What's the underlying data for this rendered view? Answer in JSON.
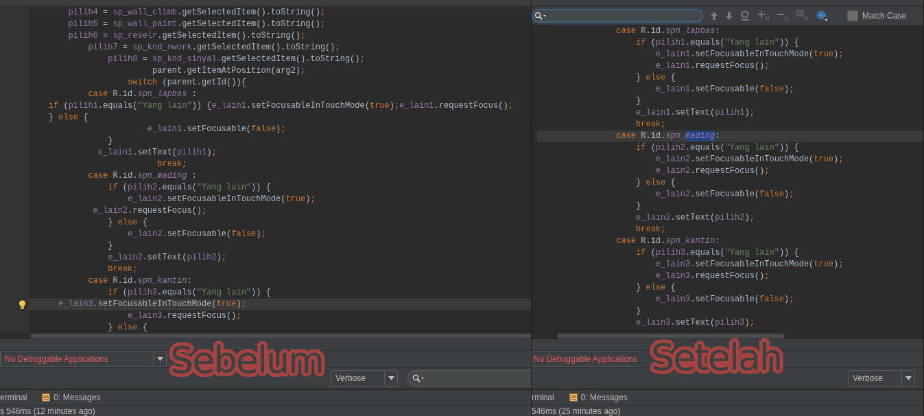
{
  "panels": [
    {
      "editor": {
        "lines": [
          {
            "current": false,
            "tokens": [
              {
                "text": "        pilih4",
                "kind": "v"
              },
              {
                "text": " = ",
                "kind": "p"
              },
              {
                "text": "sp_wall_climb",
                "kind": "v"
              },
              {
                "text": ".getSelectedItem().toString()",
                "kind": "p"
              },
              {
                "text": ";",
                "kind": "k"
              }
            ]
          },
          {
            "current": false,
            "tokens": [
              {
                "text": "        pilih5",
                "kind": "v"
              },
              {
                "text": " = ",
                "kind": "p"
              },
              {
                "text": "sp_wall_paint",
                "kind": "v"
              },
              {
                "text": ".getSelectedItem().toString()",
                "kind": "p"
              },
              {
                "text": ";",
                "kind": "k"
              }
            ]
          },
          {
            "current": false,
            "tokens": [
              {
                "text": "        pilih6",
                "kind": "v"
              },
              {
                "text": " = ",
                "kind": "p"
              },
              {
                "text": "sp_reselr",
                "kind": "v"
              },
              {
                "text": ".getSelectedItem().toString()",
                "kind": "p"
              },
              {
                "text": ";",
                "kind": "k"
              }
            ]
          },
          {
            "current": false,
            "tokens": [
              {
                "text": "            pilih7",
                "kind": "v"
              },
              {
                "text": " = ",
                "kind": "p"
              },
              {
                "text": "sp_knd_nwork",
                "kind": "v"
              },
              {
                "text": ".getSelectedItem().toString()",
                "kind": "p"
              },
              {
                "text": ";",
                "kind": "k"
              }
            ]
          },
          {
            "current": false,
            "tokens": [
              {
                "text": "                pilih8",
                "kind": "v"
              },
              {
                "text": " = ",
                "kind": "p"
              },
              {
                "text": "sp_knd_sinyal",
                "kind": "v"
              },
              {
                "text": ".getSelectedItem().toString()",
                "kind": "p"
              },
              {
                "text": ";",
                "kind": "k"
              }
            ]
          },
          {
            "current": false,
            "tokens": [
              {
                "text": "                         parent.getItemAtPosition(arg2)",
                "kind": "p"
              },
              {
                "text": ";",
                "kind": "k"
              }
            ]
          },
          {
            "current": false,
            "tokens": [
              {
                "text": "                    switch",
                "kind": "k"
              },
              {
                "text": " (parent.getId()){",
                "kind": "p"
              }
            ]
          },
          {
            "current": false,
            "tokens": [
              {
                "text": "            case",
                "kind": "k"
              },
              {
                "text": " R.id.",
                "kind": "p"
              },
              {
                "text": "spn_lapbas",
                "kind": "f"
              },
              {
                "text": " :",
                "kind": "p"
              }
            ]
          },
          {
            "current": false,
            "tokens": [
              {
                "text": "    if",
                "kind": "k"
              },
              {
                "text": " (",
                "kind": "p"
              },
              {
                "text": "pilih1",
                "kind": "v"
              },
              {
                "text": ".equals(",
                "kind": "p"
              },
              {
                "text": "\"Yang lain\"",
                "kind": "s"
              },
              {
                "text": ")) {",
                "kind": "p"
              },
              {
                "text": "e_lain1",
                "kind": "v"
              },
              {
                "text": ".setFocusableInTouchMode(",
                "kind": "p"
              },
              {
                "text": "true",
                "kind": "k"
              },
              {
                "text": ")",
                "kind": "p"
              },
              {
                "text": ";",
                "kind": "k"
              },
              {
                "text": "e_lain1",
                "kind": "v"
              },
              {
                "text": ".requestFocus()",
                "kind": "p"
              },
              {
                "text": ";",
                "kind": "k"
              }
            ]
          },
          {
            "current": false,
            "tokens": [
              {
                "text": "    } ",
                "kind": "p"
              },
              {
                "text": "else",
                "kind": "k"
              },
              {
                "text": " {",
                "kind": "p"
              }
            ]
          },
          {
            "current": false,
            "tokens": [
              {
                "text": "                        e_lain1",
                "kind": "v"
              },
              {
                "text": ".setFocusable(",
                "kind": "p"
              },
              {
                "text": "false",
                "kind": "k"
              },
              {
                "text": ")",
                "kind": "p"
              },
              {
                "text": ";",
                "kind": "k"
              }
            ]
          },
          {
            "current": false,
            "tokens": [
              {
                "text": "                }",
                "kind": "p"
              }
            ]
          },
          {
            "current": false,
            "tokens": [
              {
                "text": "              e_lain1",
                "kind": "v"
              },
              {
                "text": ".setText(",
                "kind": "p"
              },
              {
                "text": "pilih1",
                "kind": "v"
              },
              {
                "text": ")",
                "kind": "p"
              },
              {
                "text": ";",
                "kind": "k"
              }
            ]
          },
          {
            "current": false,
            "tokens": [
              {
                "text": "                          break;",
                "kind": "k"
              }
            ]
          },
          {
            "current": false,
            "tokens": [
              {
                "text": "            case",
                "kind": "k"
              },
              {
                "text": " R.id.",
                "kind": "p"
              },
              {
                "text": "spn_mading",
                "kind": "f"
              },
              {
                "text": " :",
                "kind": "p"
              }
            ]
          },
          {
            "current": false,
            "tokens": [
              {
                "text": "                if",
                "kind": "k"
              },
              {
                "text": " (",
                "kind": "p"
              },
              {
                "text": "pilih2",
                "kind": "v"
              },
              {
                "text": ".equals(",
                "kind": "p"
              },
              {
                "text": "\"Yang lain\"",
                "kind": "s"
              },
              {
                "text": ")) {",
                "kind": "p"
              }
            ]
          },
          {
            "current": false,
            "tokens": [
              {
                "text": "                    e_lain2",
                "kind": "v"
              },
              {
                "text": ".setFocusableInTouchMode(",
                "kind": "p"
              },
              {
                "text": "true",
                "kind": "k"
              },
              {
                "text": ")",
                "kind": "p"
              },
              {
                "text": ";",
                "kind": "k"
              }
            ]
          },
          {
            "current": false,
            "tokens": [
              {
                "text": "             e_lain2",
                "kind": "v"
              },
              {
                "text": ".requestFocus()",
                "kind": "p"
              },
              {
                "text": ";",
                "kind": "k"
              }
            ]
          },
          {
            "current": false,
            "tokens": [
              {
                "text": "                } ",
                "kind": "p"
              },
              {
                "text": "else",
                "kind": "k"
              },
              {
                "text": " {",
                "kind": "p"
              }
            ]
          },
          {
            "current": false,
            "tokens": [
              {
                "text": "                    e_lain2",
                "kind": "v"
              },
              {
                "text": ".setFocusable(",
                "kind": "p"
              },
              {
                "text": "false",
                "kind": "k"
              },
              {
                "text": ")",
                "kind": "p"
              },
              {
                "text": ";",
                "kind": "k"
              }
            ]
          },
          {
            "current": false,
            "tokens": [
              {
                "text": "                }",
                "kind": "p"
              }
            ]
          },
          {
            "current": false,
            "tokens": [
              {
                "text": "                e_lain2",
                "kind": "v"
              },
              {
                "text": ".setText(",
                "kind": "p"
              },
              {
                "text": "pilih2",
                "kind": "v"
              },
              {
                "text": ")",
                "kind": "p"
              },
              {
                "text": ";",
                "kind": "k"
              }
            ]
          },
          {
            "current": false,
            "tokens": [
              {
                "text": "                break;",
                "kind": "k"
              }
            ]
          },
          {
            "current": false,
            "tokens": [
              {
                "text": "            case",
                "kind": "k"
              },
              {
                "text": " R.id.",
                "kind": "p"
              },
              {
                "text": "spn_kantin",
                "kind": "f"
              },
              {
                "text": ":",
                "kind": "p"
              }
            ]
          },
          {
            "current": false,
            "tokens": [
              {
                "text": "                if",
                "kind": "k"
              },
              {
                "text": " (",
                "kind": "p"
              },
              {
                "text": "pilih3",
                "kind": "v"
              },
              {
                "text": ".equals(",
                "kind": "p"
              },
              {
                "text": "\"Yang lain\"",
                "kind": "s"
              },
              {
                "text": ")) {",
                "kind": "p"
              }
            ]
          },
          {
            "current": true,
            "bulb": true,
            "tokens": [
              {
                "text": "      e_lain3",
                "kind": "v"
              },
              {
                "text": ".setFocusableInTouchMode(",
                "kind": "p"
              },
              {
                "text": "true",
                "kind": "k"
              },
              {
                "text": ")",
                "kind": "p"
              },
              {
                "text": ";",
                "kind": "k"
              }
            ]
          },
          {
            "current": false,
            "tokens": [
              {
                "text": "                    e_lain3",
                "kind": "v"
              },
              {
                "text": ".requestFocus()",
                "kind": "p"
              },
              {
                "text": ";",
                "kind": "k"
              }
            ]
          },
          {
            "current": false,
            "tokens": [
              {
                "text": "                } ",
                "kind": "p"
              },
              {
                "text": "else",
                "kind": "k"
              },
              {
                "text": " {",
                "kind": "p"
              }
            ]
          }
        ]
      },
      "run_target": "No Debuggable Applications",
      "log_level": "Verbose",
      "log_search": true,
      "tool_windows": [
        {
          "label": "erminal",
          "kind": "plain"
        },
        {
          "label": "0: Messages",
          "kind": "messages"
        }
      ],
      "status": "s 546ms (12 minutes ago)",
      "overlay_label": "Sebelum"
    },
    {
      "find_bar": {
        "match_case": {
          "label": "Match Case",
          "checked": false
        }
      },
      "editor": {
        "lines": [
          {
            "current": false,
            "tokens": [
              {
                "text": "                case",
                "kind": "k"
              },
              {
                "text": " R.id.",
                "kind": "p"
              },
              {
                "text": "spn_lapbas",
                "kind": "f"
              },
              {
                "text": ":",
                "kind": "p"
              }
            ]
          },
          {
            "current": false,
            "tokens": [
              {
                "text": "                    if",
                "kind": "k"
              },
              {
                "text": " (",
                "kind": "p"
              },
              {
                "text": "pilih1",
                "kind": "v"
              },
              {
                "text": ".equals(",
                "kind": "p"
              },
              {
                "text": "\"Yang lain\"",
                "kind": "s"
              },
              {
                "text": ")) {",
                "kind": "p"
              }
            ]
          },
          {
            "current": false,
            "tokens": [
              {
                "text": "                        e_lain1",
                "kind": "v"
              },
              {
                "text": ".setFocusableInTouchMode(",
                "kind": "p"
              },
              {
                "text": "true",
                "kind": "k"
              },
              {
                "text": ")",
                "kind": "p"
              },
              {
                "text": ";",
                "kind": "k"
              }
            ]
          },
          {
            "current": false,
            "tokens": [
              {
                "text": "                        e_lain1",
                "kind": "v"
              },
              {
                "text": ".requestFocus()",
                "kind": "p"
              },
              {
                "text": ";",
                "kind": "k"
              }
            ]
          },
          {
            "current": false,
            "tokens": [
              {
                "text": "                    } ",
                "kind": "p"
              },
              {
                "text": "else",
                "kind": "k"
              },
              {
                "text": " {",
                "kind": "p"
              }
            ]
          },
          {
            "current": false,
            "tokens": [
              {
                "text": "                        e_lain1",
                "kind": "v"
              },
              {
                "text": ".setFocusable(",
                "kind": "p"
              },
              {
                "text": "false",
                "kind": "k"
              },
              {
                "text": ")",
                "kind": "p"
              },
              {
                "text": ";",
                "kind": "k"
              }
            ]
          },
          {
            "current": false,
            "tokens": [
              {
                "text": "                    }",
                "kind": "p"
              }
            ]
          },
          {
            "current": false,
            "tokens": [
              {
                "text": "                    e_lain1",
                "kind": "v"
              },
              {
                "text": ".setText(",
                "kind": "p"
              },
              {
                "text": "pilih1",
                "kind": "v"
              },
              {
                "text": ")",
                "kind": "p"
              },
              {
                "text": ";",
                "kind": "k"
              }
            ]
          },
          {
            "current": false,
            "tokens": [
              {
                "text": "                    break;",
                "kind": "k"
              }
            ]
          },
          {
            "current": true,
            "tokens": [
              {
                "text": "                case",
                "kind": "k"
              },
              {
                "text": " R.id.",
                "kind": "p"
              },
              {
                "text": "spn_",
                "kind": "f"
              },
              {
                "text": "mading",
                "kind": "fsel"
              },
              {
                "text": ":",
                "kind": "p"
              }
            ]
          },
          {
            "current": false,
            "tokens": [
              {
                "text": "                    if",
                "kind": "k"
              },
              {
                "text": " (",
                "kind": "p"
              },
              {
                "text": "pilih2",
                "kind": "v"
              },
              {
                "text": ".equals(",
                "kind": "p"
              },
              {
                "text": "\"Yang lain\"",
                "kind": "s"
              },
              {
                "text": ")) {",
                "kind": "p"
              }
            ]
          },
          {
            "current": false,
            "tokens": [
              {
                "text": "                        e_lain2",
                "kind": "v"
              },
              {
                "text": ".setFocusableInTouchMode(",
                "kind": "p"
              },
              {
                "text": "true",
                "kind": "k"
              },
              {
                "text": ")",
                "kind": "p"
              },
              {
                "text": ";",
                "kind": "k"
              }
            ]
          },
          {
            "current": false,
            "tokens": [
              {
                "text": "                        e_lain2",
                "kind": "v"
              },
              {
                "text": ".requestFocus()",
                "kind": "p"
              },
              {
                "text": ";",
                "kind": "k"
              }
            ]
          },
          {
            "current": false,
            "tokens": [
              {
                "text": "                    } ",
                "kind": "p"
              },
              {
                "text": "else",
                "kind": "k"
              },
              {
                "text": " {",
                "kind": "p"
              }
            ]
          },
          {
            "current": false,
            "tokens": [
              {
                "text": "                        e_lain2",
                "kind": "v"
              },
              {
                "text": ".setFocusable(",
                "kind": "p"
              },
              {
                "text": "false",
                "kind": "k"
              },
              {
                "text": ")",
                "kind": "p"
              },
              {
                "text": ";",
                "kind": "k"
              }
            ]
          },
          {
            "current": false,
            "tokens": [
              {
                "text": "                    }",
                "kind": "p"
              }
            ]
          },
          {
            "current": false,
            "tokens": [
              {
                "text": "                    e_lain2",
                "kind": "v"
              },
              {
                "text": ".setText(",
                "kind": "p"
              },
              {
                "text": "pilih2",
                "kind": "v"
              },
              {
                "text": ")",
                "kind": "p"
              },
              {
                "text": ";",
                "kind": "k"
              }
            ]
          },
          {
            "current": false,
            "tokens": [
              {
                "text": "                    break;",
                "kind": "k"
              }
            ]
          },
          {
            "current": false,
            "tokens": [
              {
                "text": "                case",
                "kind": "k"
              },
              {
                "text": " R.id.",
                "kind": "p"
              },
              {
                "text": "spn_kantin",
                "kind": "f"
              },
              {
                "text": ":",
                "kind": "p"
              }
            ]
          },
          {
            "current": false,
            "tokens": [
              {
                "text": "                    if",
                "kind": "k"
              },
              {
                "text": " (",
                "kind": "p"
              },
              {
                "text": "pilih3",
                "kind": "v"
              },
              {
                "text": ".equals(",
                "kind": "p"
              },
              {
                "text": "\"Yang lain\"",
                "kind": "s"
              },
              {
                "text": ")) {",
                "kind": "p"
              }
            ]
          },
          {
            "current": false,
            "tokens": [
              {
                "text": "                        e_lain3",
                "kind": "v"
              },
              {
                "text": ".setFocusableInTouchMode(",
                "kind": "p"
              },
              {
                "text": "true",
                "kind": "k"
              },
              {
                "text": ")",
                "kind": "p"
              },
              {
                "text": ";",
                "kind": "k"
              }
            ]
          },
          {
            "current": false,
            "tokens": [
              {
                "text": "                        e_lain3",
                "kind": "v"
              },
              {
                "text": ".requestFocus()",
                "kind": "p"
              },
              {
                "text": ";",
                "kind": "k"
              }
            ]
          },
          {
            "current": false,
            "tokens": [
              {
                "text": "                    } ",
                "kind": "p"
              },
              {
                "text": "else",
                "kind": "k"
              },
              {
                "text": " {",
                "kind": "p"
              }
            ]
          },
          {
            "current": false,
            "tokens": [
              {
                "text": "                        e_lain3",
                "kind": "v"
              },
              {
                "text": ".setFocusable(",
                "kind": "p"
              },
              {
                "text": "false",
                "kind": "k"
              },
              {
                "text": ")",
                "kind": "p"
              },
              {
                "text": ";",
                "kind": "k"
              }
            ]
          },
          {
            "current": false,
            "tokens": [
              {
                "text": "                    }",
                "kind": "p"
              }
            ]
          },
          {
            "current": false,
            "tokens": [
              {
                "text": "                    e_lain3",
                "kind": "v"
              },
              {
                "text": ".setText(",
                "kind": "p"
              },
              {
                "text": "pilih3",
                "kind": "v"
              },
              {
                "text": ")",
                "kind": "p"
              },
              {
                "text": ";",
                "kind": "k"
              }
            ]
          }
        ]
      },
      "run_target": "No Debuggable Applications",
      "log_level": "Verbose",
      "log_search": false,
      "tool_windows": [
        {
          "label": "rminal",
          "kind": "plain"
        },
        {
          "label": "0: Messages",
          "kind": "messages"
        }
      ],
      "status": "546ms (25 minutes ago)",
      "overlay_label": "Setelah"
    }
  ]
}
